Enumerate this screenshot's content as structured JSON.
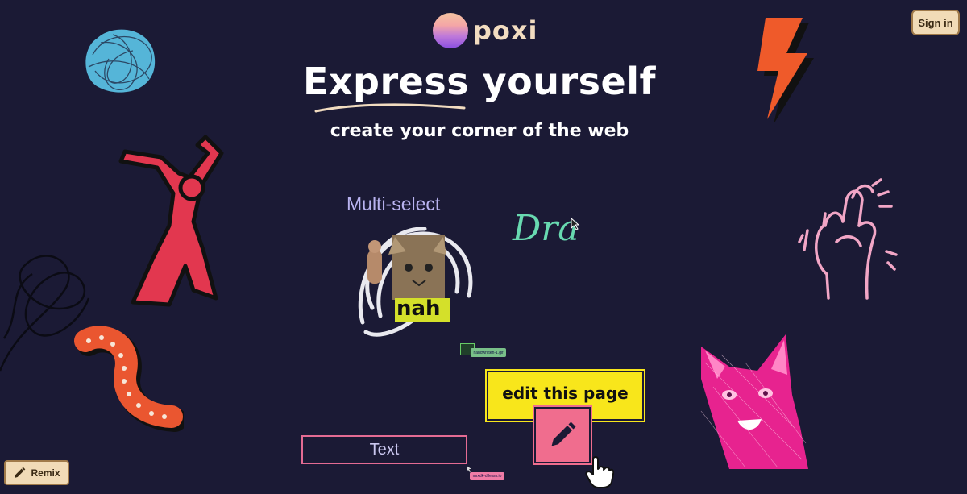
{
  "brand": {
    "name": "poxi"
  },
  "header": {
    "signin_label": "Sign in"
  },
  "hero": {
    "headline_word1": "Express",
    "headline_word2": "yourself",
    "subheadline": "create your corner of the web"
  },
  "canvas": {
    "multiselect_label": "Multi-select",
    "draw_text": "Dra",
    "sticker_caption": "nah",
    "edit_button_label": "edit this page",
    "text_box_label": "Text",
    "green_tag": "handwritten-1.gif",
    "pink_tag": "mrxdk-dflearn.io"
  },
  "footer": {
    "remix_label": "Remix"
  },
  "colors": {
    "background": "#1b1a35",
    "accent_yellow": "#f8e61b",
    "accent_pink": "#f06d8e",
    "button_cream": "#f1dbb7"
  },
  "icons": {
    "edit": "pencil-icon",
    "remix": "pencil-icon",
    "cursor": "hand-pointer-icon"
  }
}
